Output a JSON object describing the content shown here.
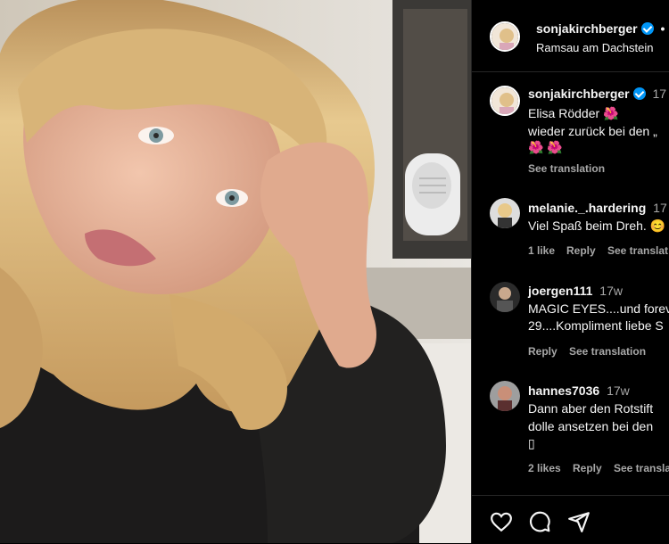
{
  "post": {
    "username": "sonjakirchberger",
    "dot": "•",
    "location": "Ramsau am Dachstein"
  },
  "caption": {
    "username": "sonjakirchberger",
    "time": "17",
    "line1": "Elisa Rödder 🌺",
    "line2": "wieder zurück bei den „",
    "line3": "🌺 🌺",
    "see_translation": "See translation"
  },
  "comments": [
    {
      "username": "melanie._.hardering",
      "time": "17",
      "text": "Viel Spaß beim Dreh. 😊",
      "likes": "1 like",
      "reply": "Reply",
      "translate": "See translat"
    },
    {
      "username": "joergen111",
      "time": "17w",
      "text1": "MAGIC EYES....und forev",
      "text2": "29....Kompliment liebe S",
      "reply": "Reply",
      "translate": "See translation"
    },
    {
      "username": "hannes7036",
      "time": "17w",
      "text1": "Dann aber den Rotstift",
      "text2": "dolle ansetzen bei den",
      "text3": "▯",
      "likes": "2 likes",
      "reply": "Reply",
      "translate": "See transla"
    }
  ],
  "icons": [
    "heart-icon",
    "comment-icon",
    "share-icon",
    "verified-icon"
  ],
  "colors": {
    "accent": "#0095f6",
    "bg": "#000000",
    "muted": "#a8a8a8"
  }
}
